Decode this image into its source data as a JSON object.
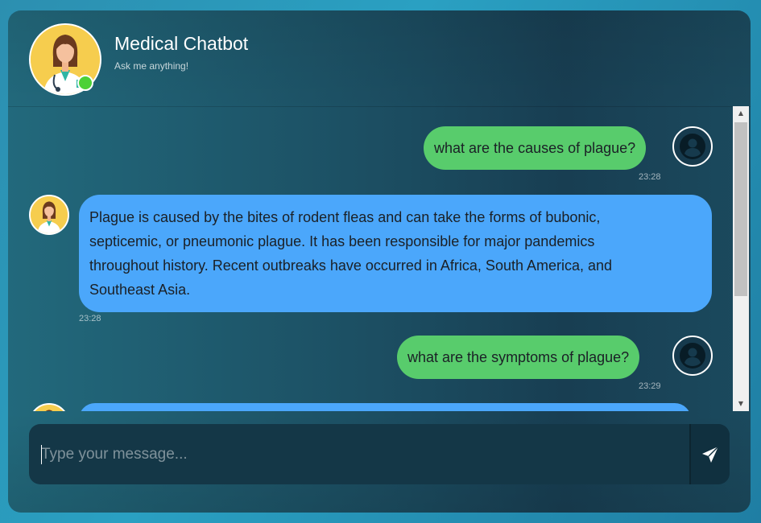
{
  "header": {
    "title": "Medical Chatbot",
    "subtitle": "Ask me anything!",
    "status": "online",
    "avatar_icon": "doctor-avatar-icon"
  },
  "messages": [
    {
      "sender": "user",
      "text": "what are the causes of plague?",
      "time": "23:28"
    },
    {
      "sender": "bot",
      "lines": [
        "Plague is caused by the bites of rodent fleas and can take the forms of bubonic,",
        "septicemic, or pneumonic plague. It has been responsible for major pandemics",
        "throughout history. Recent outbreaks have occurred in Africa, South America, and",
        "Southeast Asia."
      ],
      "time": "23:28"
    },
    {
      "sender": "user",
      "text": "what are the symptoms of plague?",
      "time": "23:29"
    }
  ],
  "composer": {
    "placeholder": "Type your message...",
    "value": "",
    "send_icon": "send-icon"
  },
  "colors": {
    "user_bubble": "#58cc6c",
    "bot_bubble": "#4ba7fb",
    "online": "#4cd137"
  }
}
